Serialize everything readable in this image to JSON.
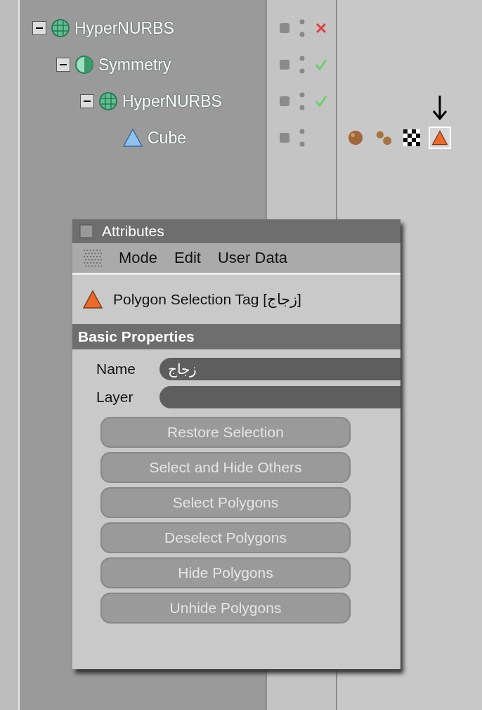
{
  "object_tree": [
    {
      "label": "HyperNURBS",
      "kind": "nurbs",
      "expanded": true,
      "enabled": false,
      "children": [
        {
          "label": "Symmetry",
          "kind": "symmetry",
          "expanded": true,
          "enabled": true,
          "children": [
            {
              "label": "HyperNURBS",
              "kind": "nurbs",
              "expanded": true,
              "enabled": true,
              "children": [
                {
                  "label": "Cube",
                  "kind": "cube",
                  "tags": [
                    {
                      "kind": "texture",
                      "selected": false
                    },
                    {
                      "kind": "spheres",
                      "selected": false
                    },
                    {
                      "kind": "checker",
                      "selected": false
                    },
                    {
                      "kind": "selection",
                      "selected": true
                    }
                  ]
                }
              ]
            }
          ]
        }
      ]
    }
  ],
  "attributes": {
    "title": "Attributes",
    "menu": [
      "Mode",
      "Edit",
      "User Data"
    ],
    "object_title": "Polygon Selection Tag [زجاج]",
    "section": "Basic Properties",
    "fields": [
      {
        "label": "Name",
        "value": "زجاج"
      },
      {
        "label": "Layer"
      }
    ],
    "buttons": [
      {
        "label": "Restore Selection",
        "disabled": true
      },
      {
        "label": "Select and Hide Others",
        "disabled": true
      },
      {
        "label": "Select Polygons",
        "disabled": true
      },
      {
        "label": "Deselect Polygons",
        "disabled": true
      },
      {
        "label": "Hide Polygons",
        "disabled": true
      },
      {
        "label": "Unhide Polygons",
        "disabled": true
      }
    ]
  }
}
